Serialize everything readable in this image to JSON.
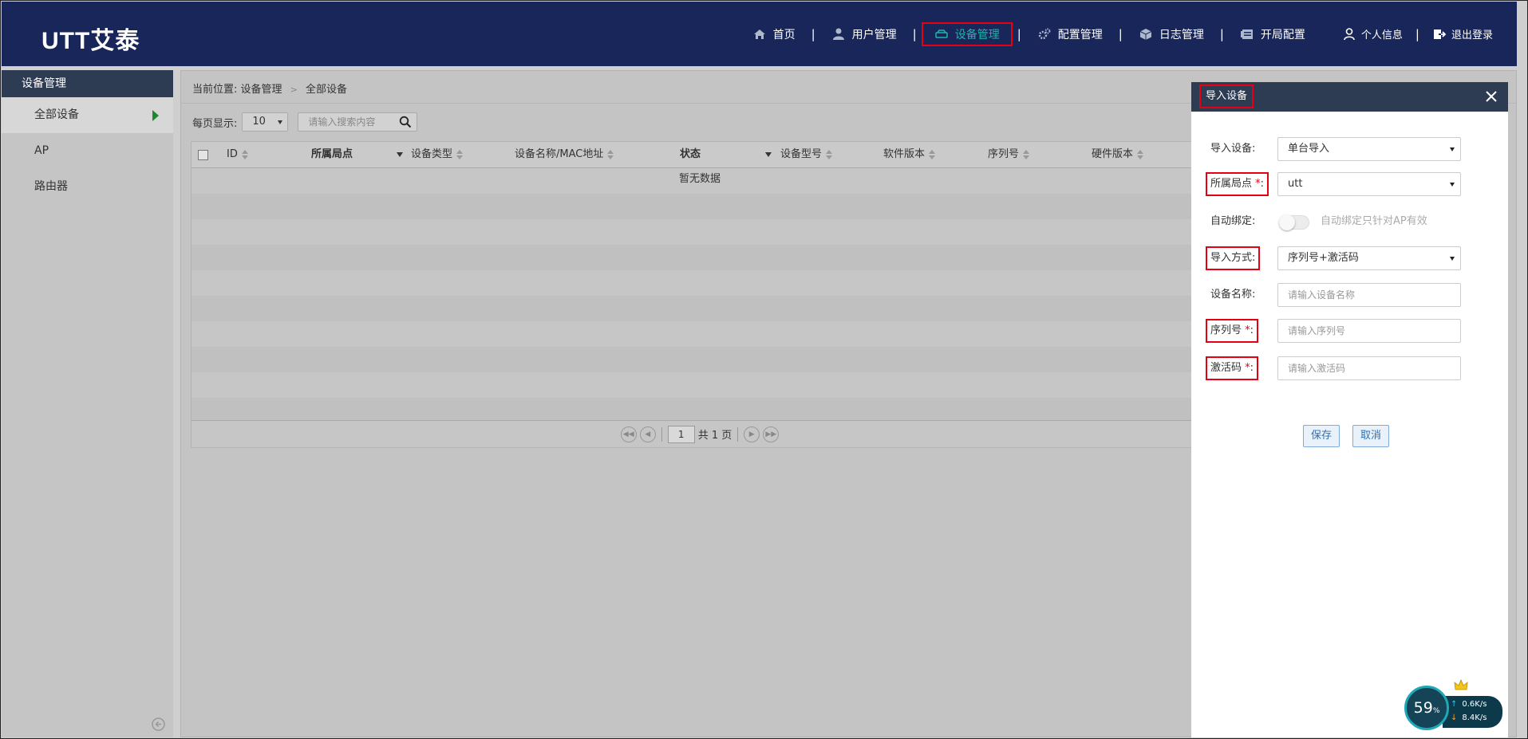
{
  "header": {
    "logo": "UTT艾泰",
    "nav": [
      {
        "label": "首页",
        "icon": "home-icon"
      },
      {
        "label": "用户管理",
        "icon": "user-icon"
      },
      {
        "label": "设备管理",
        "icon": "device-icon",
        "active": true
      },
      {
        "label": "配置管理",
        "icon": "gears-icon"
      },
      {
        "label": "日志管理",
        "icon": "cube-icon"
      },
      {
        "label": "开局配置",
        "icon": "server-icon"
      }
    ],
    "separator": "|",
    "profile_label": "个人信息",
    "logout_label": "退出登录"
  },
  "sidebar": {
    "title": "设备管理",
    "items": [
      {
        "label": "全部设备",
        "active": true
      },
      {
        "label": "AP"
      },
      {
        "label": "路由器"
      }
    ]
  },
  "breadcrumb": {
    "prefix": "当前位置:",
    "level1": "设备管理",
    "separator": ">",
    "level2": "全部设备"
  },
  "toolbar": {
    "per_page_label": "每页显示:",
    "per_page_value": "10",
    "search_placeholder": "请输入搜索内容"
  },
  "table": {
    "columns": {
      "id": "ID",
      "site": "所属局点",
      "type": "设备类型",
      "name_mac": "设备名称/MAC地址",
      "status": "状态",
      "model": "设备型号",
      "software": "软件版本",
      "serial": "序列号",
      "hardware": "硬件版本"
    },
    "empty_text": "暂无数据"
  },
  "pager": {
    "current_page": "1",
    "total_text": "共 1 页"
  },
  "modal": {
    "title": "导入设备",
    "fields": {
      "import_device": {
        "label": "导入设备:",
        "value": "单台导入"
      },
      "site": {
        "label": "所属局点",
        "required_mark": "*",
        "suffix": ":",
        "value": "utt"
      },
      "auto_bind": {
        "label": "自动绑定:",
        "hint": "自动绑定只针对AP有效"
      },
      "import_method": {
        "label": "导入方式:",
        "value": "序列号+激活码"
      },
      "device_name": {
        "label": "设备名称:",
        "placeholder": "请输入设备名称"
      },
      "serial": {
        "label": "序列号",
        "required_mark": "*",
        "suffix": ":",
        "placeholder": "请输入序列号"
      },
      "activation": {
        "label": "激活码",
        "required_mark": "*",
        "suffix": ":",
        "placeholder": "请输入激活码"
      }
    },
    "save_label": "保存",
    "cancel_label": "取消"
  },
  "speed_widget": {
    "percent": "59",
    "percent_unit": "%",
    "upload": "0.6K/s",
    "download": "8.4K/s"
  },
  "colors": {
    "header_bg": "#19265a",
    "active_nav_text": "#1fb5a8",
    "highlight_border": "#e60012",
    "panel_header_bg": "#2d3b53"
  }
}
